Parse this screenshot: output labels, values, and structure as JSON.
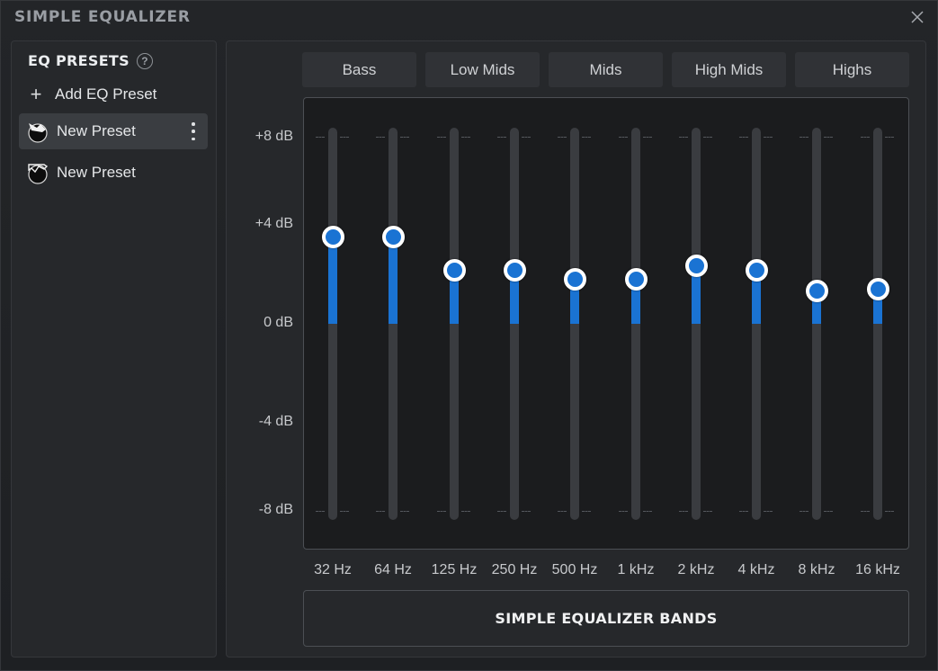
{
  "window": {
    "title": "SIMPLE EQUALIZER"
  },
  "presets": {
    "title": "EQ PRESETS",
    "help_glyph": "?",
    "add_label": "Add EQ Preset",
    "items": [
      {
        "label": "New Preset",
        "selected": true
      },
      {
        "label": "New Preset",
        "selected": false
      }
    ]
  },
  "eq": {
    "groups": [
      "Bass",
      "Low Mids",
      "Mids",
      "High Mids",
      "Highs"
    ],
    "db_labels": [
      "+8 dB",
      "+4 dB",
      "0 dB",
      "-4 dB",
      "-8 dB"
    ],
    "range_db": [
      -8,
      8
    ],
    "bands": [
      {
        "freq": "32 Hz",
        "gain_db": 3.7
      },
      {
        "freq": "64 Hz",
        "gain_db": 3.7
      },
      {
        "freq": "125 Hz",
        "gain_db": 2.3
      },
      {
        "freq": "250 Hz",
        "gain_db": 2.3
      },
      {
        "freq": "500 Hz",
        "gain_db": 1.9
      },
      {
        "freq": "1 kHz",
        "gain_db": 1.9
      },
      {
        "freq": "2 kHz",
        "gain_db": 2.5
      },
      {
        "freq": "4 kHz",
        "gain_db": 2.3
      },
      {
        "freq": "8 kHz",
        "gain_db": 1.4
      },
      {
        "freq": "16 kHz",
        "gain_db": 1.5
      }
    ],
    "bands_button_label": "SIMPLE EQUALIZER BANDS"
  },
  "colors": {
    "accent": "#1a73d3",
    "background": "#202225",
    "panel": "#26282b"
  }
}
